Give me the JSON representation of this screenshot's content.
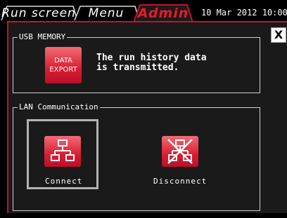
{
  "tabs": [
    {
      "label": "Run screen"
    },
    {
      "label": "Menu"
    },
    {
      "label": "Admin",
      "active": true
    }
  ],
  "datetime": "10 Mar 2012 10:00",
  "close_label": "X",
  "usb": {
    "group_label": "USB MEMORY",
    "export_label_line1": "DATA",
    "export_label_line2": "EXPORT",
    "message_line1": "The run history data",
    "message_line2": "is transmitted."
  },
  "lan": {
    "group_label": "LAN Communication",
    "connect_label": "Connect",
    "disconnect_label": "Disconnect"
  },
  "colors": {
    "accent": "#d91e31",
    "panel": "#1a1a1a",
    "border": "#c8102e"
  }
}
